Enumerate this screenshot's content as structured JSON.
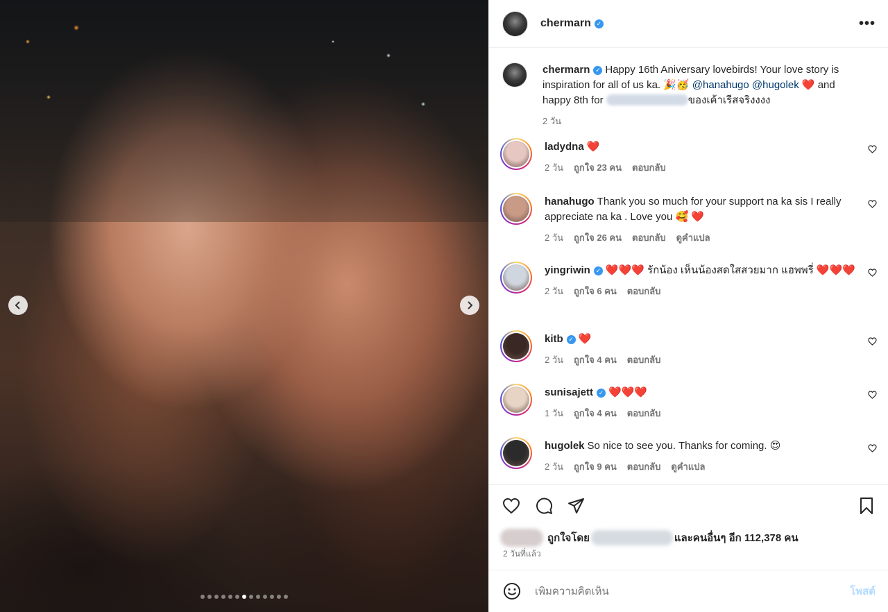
{
  "photo": {
    "prev_icon": "chevron-left-icon",
    "next_icon": "chevron-right-icon",
    "slide_count": 13,
    "active_slide": 6
  },
  "header": {
    "username": "chermarn",
    "verified": true,
    "more_icon": "more-dots-icon",
    "more_label": "•••"
  },
  "caption": {
    "username": "chermarn",
    "text_1": "Happy 16th Aniversary lovebirds! Your love story is inspiration for all of us ka. 🎉🥳 ",
    "mention_1": "@hanahugo",
    "mention_2": "@hugolek",
    "text_2": " ❤️ and happy 8th for ",
    "text_3": "ของเค้าเรีสจริงงงง",
    "time": "2 วัน"
  },
  "comments": [
    {
      "username": "ladydna",
      "verified": false,
      "text": "❤️",
      "time": "2 วัน",
      "likes": "ถูกใจ 23 คน",
      "reply": "ตอบกลับ",
      "translate": "",
      "avatar_color": "#e7c7c2"
    },
    {
      "username": "hanahugo",
      "verified": false,
      "text": "Thank you so much for your support na ka sis I really appreciate na ka . Love you 🥰 ❤️",
      "time": "2 วัน",
      "likes": "ถูกใจ 26 คน",
      "reply": "ตอบกลับ",
      "translate": "ดูคำแปล",
      "avatar_color": "#c99a86"
    },
    {
      "username": "yingriwin",
      "verified": true,
      "text": "❤️❤️❤️ รักน้อง เห็นน้องสดใสสวยมาก แฮพพรี่ ❤️❤️❤️",
      "time": "2 วัน",
      "likes": "ถูกใจ 6 คน",
      "reply": "ตอบกลับ",
      "translate": "",
      "avatar_color": "#cfd6df"
    },
    {
      "username": "kitb",
      "verified": true,
      "text": "❤️",
      "time": "2 วัน",
      "likes": "ถูกใจ 4 คน",
      "reply": "ตอบกลับ",
      "translate": "",
      "avatar_color": "#3a2824"
    },
    {
      "username": "sunisajett",
      "verified": true,
      "text": "❤️❤️❤️",
      "time": "1 วัน",
      "likes": "ถูกใจ 4 คน",
      "reply": "ตอบกลับ",
      "translate": "",
      "avatar_color": "#e8d4c4"
    },
    {
      "username": "hugolek",
      "verified": false,
      "text": "So nice to see you. Thanks for coming. 😍",
      "time": "2 วัน",
      "likes": "ถูกใจ 9 คน",
      "reply": "ตอบกลับ",
      "translate": "ดูคำแปล",
      "avatar_color": "#2b2b2b"
    }
  ],
  "actions": {
    "like_icon": "heart-icon",
    "comment_icon": "comment-bubble-icon",
    "share_icon": "paper-plane-icon",
    "save_icon": "bookmark-icon",
    "liked_by_prefix": "ถูกใจโดย",
    "liked_by_suffix": "และคนอื่นๆ อีก 112,378 คน",
    "posted_time": "2 วันที่แล้ว"
  },
  "add_comment": {
    "emoji_icon": "smiley-icon",
    "placeholder": "เพิ่มความคิดเห็น",
    "post_label": "โพสต์"
  },
  "colors": {
    "verified": "#3797f0",
    "post_disabled": "#b3dbff",
    "mention": "#00376b",
    "text_secondary": "#737373"
  }
}
